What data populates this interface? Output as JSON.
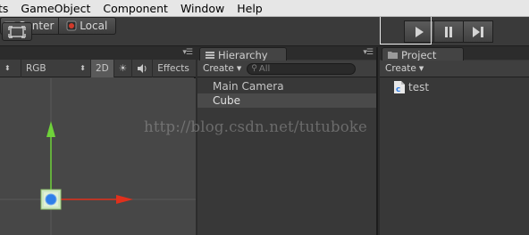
{
  "menubar": {
    "items": [
      "ts",
      "GameObject",
      "Component",
      "Window",
      "Help"
    ]
  },
  "toolbar": {
    "hand_tool_icon": "move-view-icon",
    "pivot_center_label": "Center",
    "pivot_local_label": "Local",
    "play_icon": "play-icon",
    "pause_icon": "pause-icon",
    "step_icon": "step-icon"
  },
  "scene": {
    "color_mode": "RGB",
    "mode_2d": "2D",
    "effects_label": "Effects",
    "gizmo_colors": {
      "y_axis": "#6fd23a",
      "x_axis": "#e0301c",
      "center": "#2f7fe8"
    }
  },
  "hierarchy": {
    "tab_label": "Hierarchy",
    "create_label": "Create",
    "search_placeholder": "All",
    "items": [
      {
        "label": "Main Camera",
        "selected": false
      },
      {
        "label": "Cube",
        "selected": true
      }
    ]
  },
  "project": {
    "tab_label": "Project",
    "create_label": "Create",
    "items": [
      {
        "label": "test",
        "icon": "csharp-script-icon"
      }
    ]
  },
  "watermark": "http://blog.csdn.net/tutuboke"
}
